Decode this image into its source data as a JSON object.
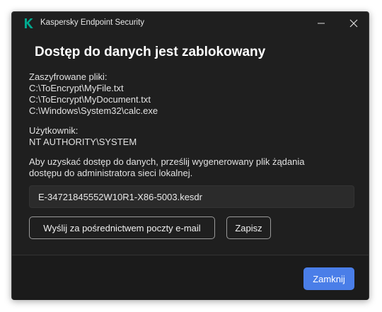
{
  "window": {
    "app_title": "Kaspersky Endpoint Security",
    "heading": "Dostęp do danych jest zablokowany"
  },
  "files": {
    "label": "Zaszyfrowane pliki:",
    "items": [
      "C:\\ToEncrypt\\MyFile.txt",
      "C:\\ToEncrypt\\MyDocument.txt",
      "C:\\Windows\\System32\\calc.exe"
    ]
  },
  "user": {
    "label": "Użytkownik:",
    "value": "NT AUTHORITY\\SYSTEM"
  },
  "info": {
    "line1": "Aby uzyskać dostęp do danych, prześlij wygenerowany plik żądania",
    "line2": "dostępu do administratora sieci lokalnej."
  },
  "request_file": {
    "value": "E-34721845552W10R1-X86-5003.kesdr"
  },
  "actions": {
    "email_label": "Wyślij za pośrednictwem poczty e-mail",
    "save_label": "Zapisz",
    "close_label": "Zamknij"
  },
  "colors": {
    "background": "#1f1f1f",
    "accent": "#4a7ee8",
    "logo": "#00a88e"
  }
}
